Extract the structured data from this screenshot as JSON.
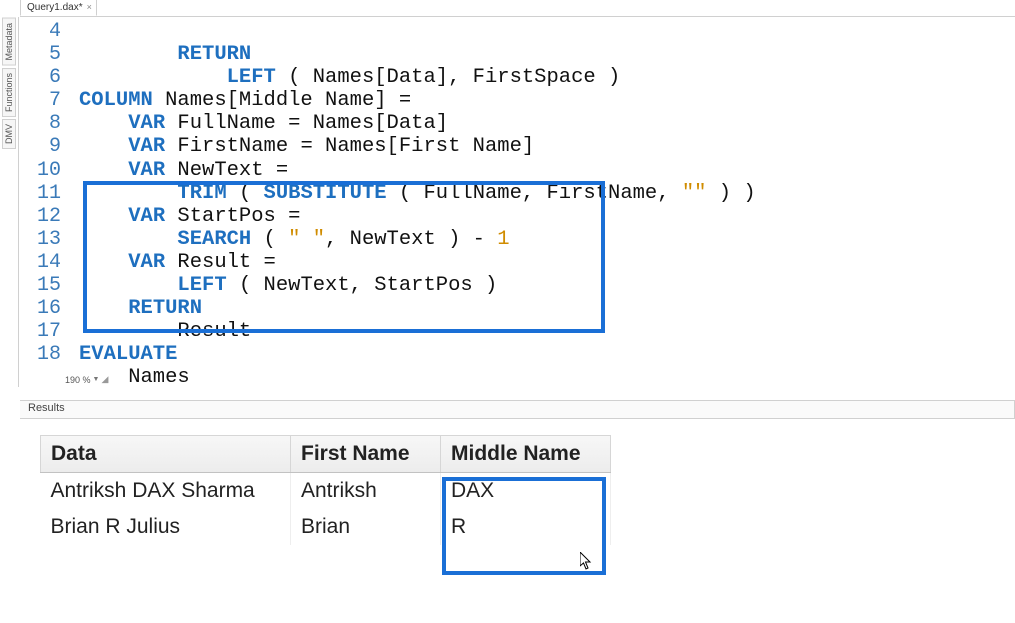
{
  "file_tab": {
    "name": "Query1.dax*"
  },
  "side_panels": {
    "metadata": "Metadata",
    "functions": "Functions",
    "dmv": "DMV"
  },
  "zoom": "190 %",
  "code": {
    "lines_start": 4,
    "lines_end": 18,
    "l4": "        RETURN",
    "l5": "            LEFT ( Names[Data], FirstSpace )",
    "l6": "COLUMN Names[Middle Name] =",
    "l7": "    VAR FullName = Names[Data]",
    "l8": "    VAR FirstName = Names[First Name]",
    "l9": "    VAR NewText =",
    "l10": "        TRIM ( SUBSTITUTE ( FullName, FirstName, \"\" ) )",
    "l11": "    VAR StartPos =",
    "l12": "        SEARCH ( \" \", NewText ) - 1",
    "l13": "    VAR Result =",
    "l14": "        LEFT ( NewText, StartPos )",
    "l15": "    RETURN",
    "l16": "        Result",
    "l17": "EVALUATE",
    "l18": "    Names"
  },
  "results": {
    "panel_title": "Results",
    "columns": [
      "Data",
      "First Name",
      "Middle Name"
    ],
    "rows": [
      {
        "data": "Antriksh DAX Sharma",
        "first": "Antriksh",
        "middle": "DAX"
      },
      {
        "data": "Brian R Julius",
        "first": "Brian",
        "middle": "R"
      }
    ]
  },
  "highlight_boxes": {
    "code_box_note": "lines 11–16 highlighted",
    "results_col_note": "Middle Name column highlighted"
  }
}
